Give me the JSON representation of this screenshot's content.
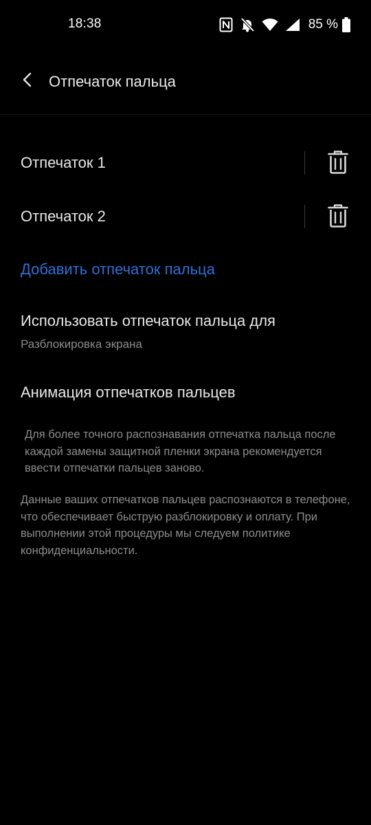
{
  "status_bar": {
    "time": "18:38",
    "battery_percent": "85 %",
    "icons": [
      "nfc-icon",
      "bell-off-icon",
      "wifi-icon",
      "signal-icon",
      "battery-icon"
    ]
  },
  "header": {
    "back_icon": "chevron-left-icon",
    "title": "Отпечаток пальца"
  },
  "fingerprints": [
    {
      "label": "Отпечаток 1",
      "action_icon": "trash-icon"
    },
    {
      "label": "Отпечаток 2",
      "action_icon": "trash-icon"
    }
  ],
  "add_fingerprint_label": "Добавить отпечаток пальца",
  "use_for": {
    "title": "Использовать отпечаток пальца для",
    "value": "Разблокировка экрана"
  },
  "animation_label": "Анимация отпечатков пальцев",
  "hint_text": "Для более точного распознавания отпечатка пальца после каждой замены защитной пленки экрана рекомендуется ввести отпечатки пальцев заново.",
  "privacy_text": "Данные ваших отпечатков пальцев распознаются в телефоне, что обеспечивает быструю разблокировку и оплату. При выполнении этой процедуры мы следуем политике конфиденциальности.",
  "colors": {
    "background": "#000000",
    "accent_link": "#2f6fd6",
    "primary_text": "#e8e8e8",
    "secondary_text": "#8c8c8c"
  }
}
